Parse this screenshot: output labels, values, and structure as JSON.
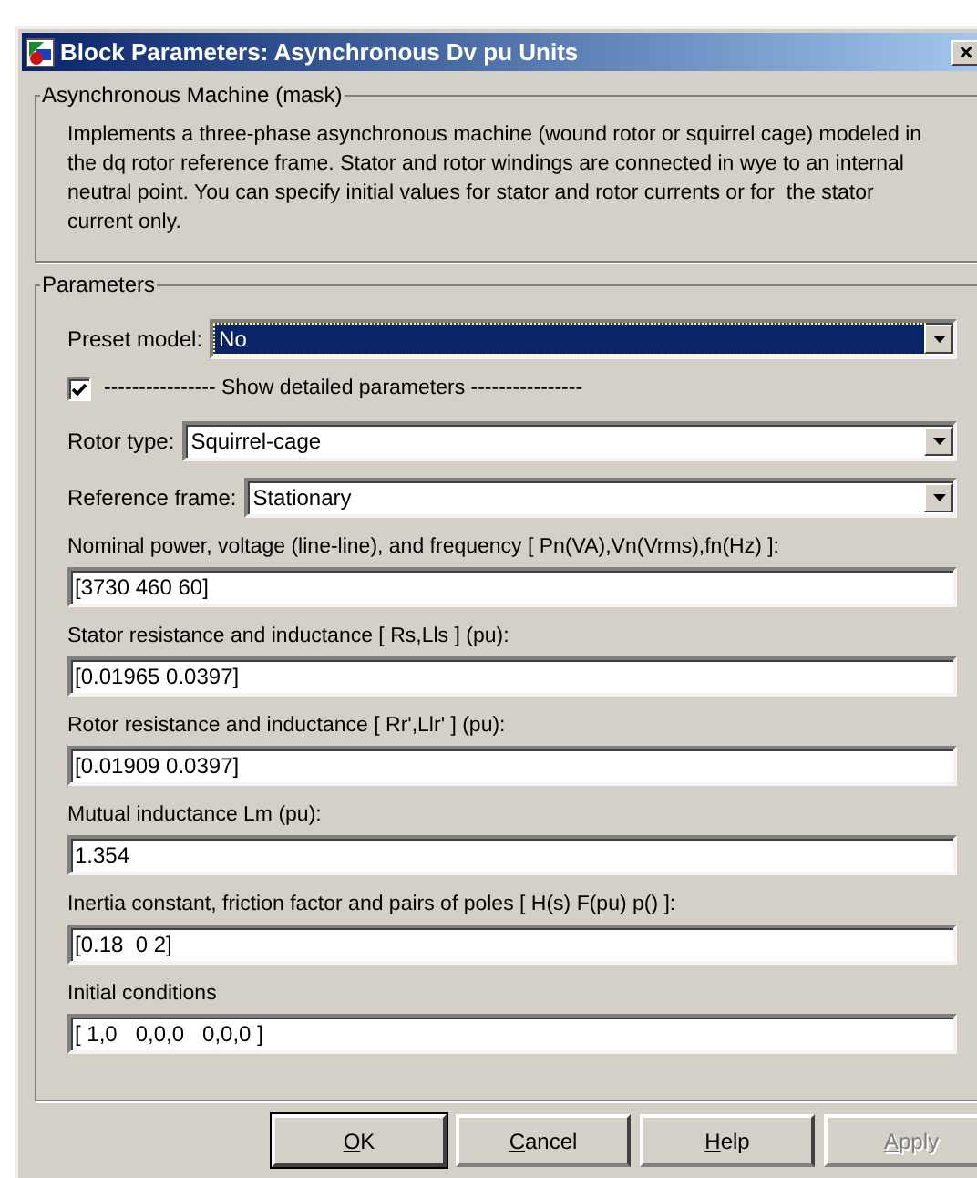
{
  "window": {
    "title": "Block Parameters: Asynchronous Dv pu Units",
    "close": "×"
  },
  "description_group": {
    "title": "Asynchronous Machine (mask)",
    "text": "Implements a three-phase asynchronous machine (wound rotor or squirrel cage) modeled in the dq rotor reference frame. Stator and rotor windings are connected in wye to an internal neutral point. You can specify initial values for stator and rotor currents or for  the stator current only."
  },
  "parameters_group": {
    "title": "Parameters",
    "items": [
      {
        "kind": "dropdown",
        "label": "Preset model:",
        "value": "No",
        "focused": true
      },
      {
        "kind": "checkbox",
        "label": "---------------- Show detailed parameters ----------------",
        "checked": true
      },
      {
        "kind": "dropdown",
        "label": "Rotor type:",
        "value": "Squirrel-cage",
        "focused": false
      },
      {
        "kind": "dropdown",
        "label": "Reference frame:",
        "value": "Stationary",
        "focused": false
      },
      {
        "kind": "text",
        "label": "Nominal power, voltage (line-line), and frequency  [ Pn(VA),Vn(Vrms),fn(Hz) ]:",
        "value": "[3730 460 60]"
      },
      {
        "kind": "text",
        "label": "Stator resistance and inductance  [ Rs,Lls ] (pu):",
        "value": "[0.01965 0.0397]"
      },
      {
        "kind": "text",
        "label": "Rotor resistance and inductance  [ Rr',Llr' ] (pu):",
        "value": "[0.01909 0.0397]"
      },
      {
        "kind": "text",
        "label": "Mutual inductance Lm (pu):",
        "value": "1.354"
      },
      {
        "kind": "text",
        "label": "Inertia constant, friction factor and pairs of poles [ H(s) F(pu) p() ]:",
        "value": "[0.18  0 2]"
      },
      {
        "kind": "text",
        "label": "Initial conditions",
        "value": "[ 1,0   0,0,0   0,0,0 ]"
      }
    ]
  },
  "buttons": [
    {
      "label": "OK",
      "default": true,
      "disabled": false
    },
    {
      "label": "Cancel",
      "default": false,
      "disabled": false
    },
    {
      "label": "Help",
      "default": false,
      "disabled": false
    },
    {
      "label": "Apply",
      "default": false,
      "disabled": true
    }
  ]
}
